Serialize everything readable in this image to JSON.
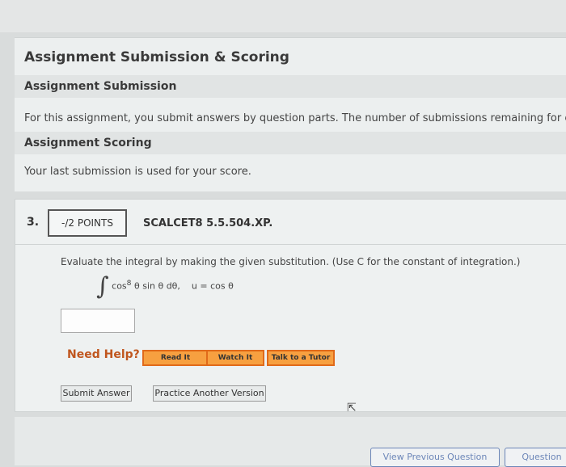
{
  "scoring": {
    "title": "Assignment Submission & Scoring",
    "submission_heading": "Assignment Submission",
    "submission_text": "For this assignment, you submit answers by question parts. The number of submissions remaining for ea",
    "scoring_heading": "Assignment Scoring",
    "scoring_text": "Your last submission is used for your score."
  },
  "question": {
    "number": "3.",
    "points": "-/2 POINTS",
    "id": "SCALCET8 5.5.504.XP.",
    "prompt": "Evaluate the integral by making the given substitution. (Use C for the constant of integration.)",
    "integral_sign": "∫",
    "integrand": "cos",
    "exponent": "8",
    "integrand_rest": " θ sin θ dθ,",
    "substitution": "u = cos θ",
    "answer_value": ""
  },
  "help": {
    "label": "Need Help?",
    "read_it": "Read It",
    "watch_it": "Watch It",
    "talk_to_tutor": "Talk to a Tutor"
  },
  "actions": {
    "submit": "Submit Answer",
    "practice": "Practice Another Version"
  },
  "nav": {
    "previous": "View Previous Question",
    "next": "Question"
  },
  "colors": {
    "help_orange": "#f7a040",
    "need_help_text": "#c0561e",
    "nav_blue": "#6c86b8"
  }
}
